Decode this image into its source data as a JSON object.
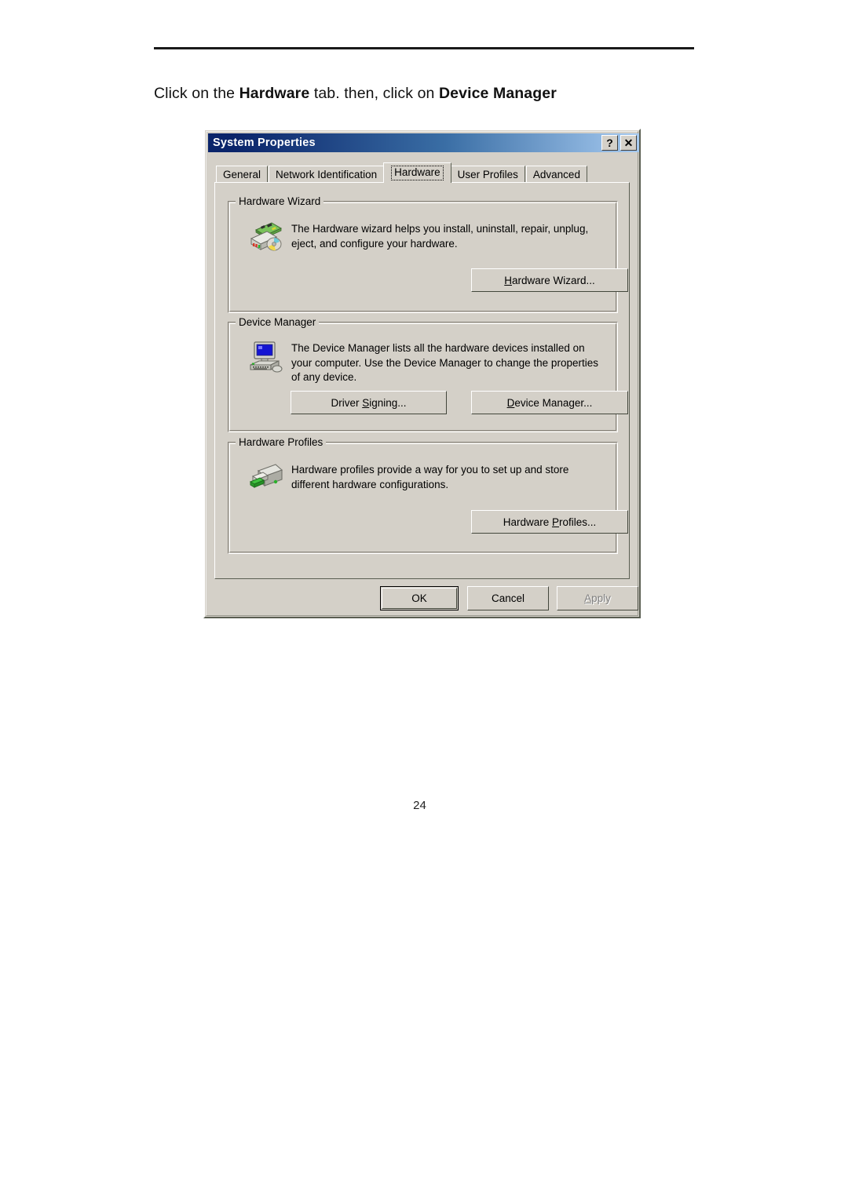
{
  "page": {
    "heading_parts": [
      {
        "text": "Click on the ",
        "bold": false
      },
      {
        "text": "Hardware",
        "bold": true
      },
      {
        "text": " tab. then, click on ",
        "bold": false
      },
      {
        "text": "Device Manager",
        "bold": true
      }
    ],
    "heading_plain": "Click on the Hardware tab. then, click on Device Manager",
    "page_number": "24"
  },
  "dialog": {
    "title": "System Properties",
    "titlebar_buttons": [
      {
        "name": "help-button",
        "glyph": "?"
      },
      {
        "name": "close-button",
        "glyph": "✕"
      }
    ],
    "tabs": [
      {
        "label": "General",
        "selected": false
      },
      {
        "label": "Network Identification",
        "selected": false
      },
      {
        "label": "Hardware",
        "selected": true
      },
      {
        "label": "User Profiles",
        "selected": false
      },
      {
        "label": "Advanced",
        "selected": false
      }
    ],
    "groups": [
      {
        "id": "hardware-wizard",
        "title": "Hardware Wizard",
        "icon": "hardware-board-icon",
        "description": "The Hardware wizard helps you install, uninstall, repair, unplug, eject, and configure your hardware.",
        "buttons": [
          {
            "id": "hardware-wizard-button",
            "label": "Hardware Wizard...",
            "accel": "H",
            "disabled": false
          }
        ]
      },
      {
        "id": "device-manager",
        "title": "Device Manager",
        "icon": "computer-icon",
        "description": "The Device Manager lists all the hardware devices installed on your computer. Use the Device Manager to change the properties of any device.",
        "buttons": [
          {
            "id": "driver-signing-button",
            "label": "Driver Signing...",
            "accel": "S",
            "disabled": false
          },
          {
            "id": "device-manager-button",
            "label": "Device Manager...",
            "accel": "D",
            "disabled": false
          }
        ]
      },
      {
        "id": "hardware-profiles",
        "title": "Hardware Profiles",
        "icon": "hardware-profile-icon",
        "description": "Hardware profiles provide a way for you to set up and store different hardware configurations.",
        "buttons": [
          {
            "id": "hardware-profiles-button",
            "label": "Hardware Profiles...",
            "accel": "P",
            "disabled": false
          }
        ]
      }
    ],
    "footer_buttons": [
      {
        "id": "ok-button",
        "label": "OK",
        "default": true,
        "disabled": false
      },
      {
        "id": "cancel-button",
        "label": "Cancel",
        "default": false,
        "disabled": false
      },
      {
        "id": "apply-button",
        "label": "Apply",
        "accel": "A",
        "default": false,
        "disabled": true
      }
    ]
  },
  "colors": {
    "dialog_face": "#d4d0c8",
    "titlebar_start": "#0a246a",
    "titlebar_end": "#a6caf0",
    "title_text": "#ffffff",
    "disabled_text": "#808080",
    "page_background": "#ffffff",
    "rule": "#1a1a1a"
  }
}
